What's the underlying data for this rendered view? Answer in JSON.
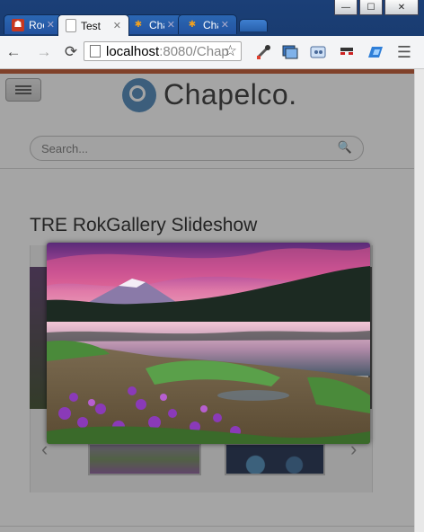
{
  "window": {
    "controls": {
      "minimize": "—",
      "maximize": "☐",
      "close": "✕"
    }
  },
  "tabs": [
    {
      "label": "Rock",
      "icon": "red-favicon-icon",
      "active": false
    },
    {
      "label": "Test",
      "icon": "page-icon",
      "active": true
    },
    {
      "label": "Chap",
      "icon": "joomla-icon",
      "active": false
    },
    {
      "label": "Chap",
      "icon": "joomla-icon",
      "active": false
    }
  ],
  "toolbar": {
    "back": "←",
    "forward": "→",
    "reload": "⟳",
    "url_host": "localhost",
    "url_rest": ":8080/Chap",
    "star": "☆",
    "menu": "☰"
  },
  "site": {
    "logo_text": "Chapelco.",
    "search_placeholder": "Search...",
    "gallery_title": "TRE RokGallery Slideshow",
    "prev_arrow": "‹",
    "next_arrow": "›"
  },
  "colors": {
    "accent_bar": "#c0532b",
    "logo_blue": "#4a86b8",
    "chrome_blue": "#1b3f77"
  }
}
